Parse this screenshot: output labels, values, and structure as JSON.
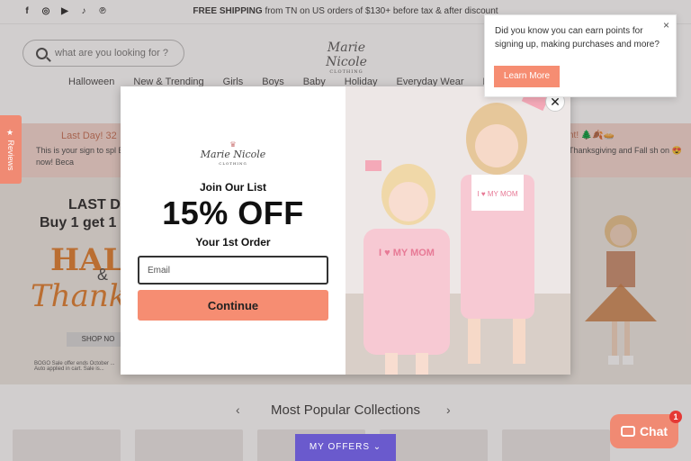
{
  "topbar": {
    "social_icons": [
      "facebook-icon",
      "instagram-icon",
      "youtube-icon",
      "tiktok-icon",
      "pinterest-icon"
    ],
    "promo_bold": "FREE SHIPPING",
    "promo_text": " from TN on US orders of $130+ before tax & after discount"
  },
  "header": {
    "search_placeholder": "what are you looking for ?",
    "logo_text": "Marie Nicole",
    "logo_sub": "CLOTHING",
    "nav": [
      "Halloween",
      "New & Trending",
      "Girls",
      "Boys",
      "Baby",
      "Holiday",
      "Everyday Wear",
      "B"
    ]
  },
  "banner": {
    "left_title": "Last Day! 32",
    "left_text": "This is your sign to spl BIG now! Beca",
    "right_title": "nt! 🌲🍂🥧",
    "right_text": "Thanksgiving and Fall sh on 😍"
  },
  "hero": {
    "line1": "LAST DA",
    "line2": "Buy 1 get 1 5",
    "line3": "HALLOW",
    "line4": "&",
    "line5": "Thanksgi",
    "shop": "SHOP NO",
    "fine": "BOGO Sale offer ends October ... Auto applied in cart. Sale is..."
  },
  "collections": {
    "title": "Most Popular Collections",
    "prev": "‹",
    "next": "›"
  },
  "reviews_tab": "★ Reviews",
  "my_offers": "MY OFFERS ⌄",
  "chat": {
    "label": "Chat",
    "badge": "1"
  },
  "modal": {
    "logo_text": "Marie Nicole",
    "logo_sub": "CLOTHING",
    "join": "Join Our List",
    "offer": "15% OFF",
    "first_order": "Your 1st Order",
    "email_placeholder": "Email",
    "continue": "Continue",
    "close": "✕",
    "shirt_text": "I ♥ MY MOM"
  },
  "toast": {
    "message": "Did you know you can earn points for signing up, making purchases and more?",
    "close": "×",
    "learn_more": "Learn More"
  },
  "colors": {
    "accent": "#f68d72",
    "offers": "#6a5acd",
    "banner": "#f5d7cf"
  }
}
